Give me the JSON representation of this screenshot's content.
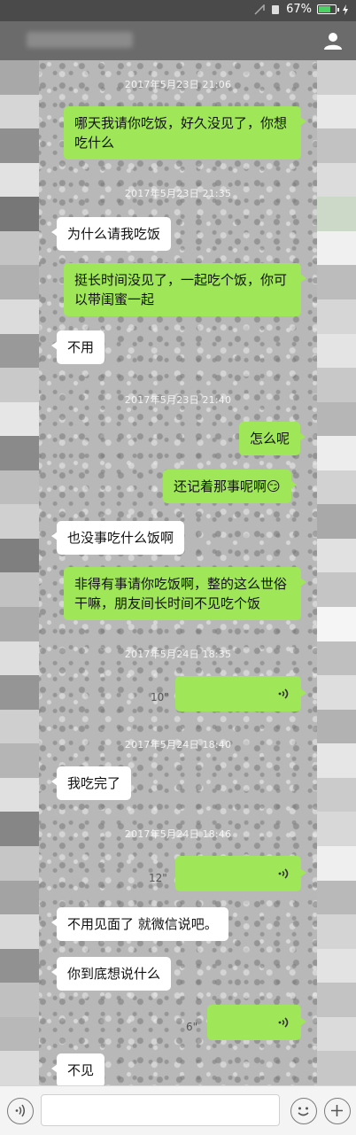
{
  "status_bar": {
    "battery_text": "67%",
    "battery_level": 0.67,
    "icons": [
      "signal-arrow-icon",
      "sim-icon",
      "battery-icon",
      "charging-bolt-icon"
    ]
  },
  "header": {
    "contact_icon": "person-icon"
  },
  "messages": [
    {
      "kind": "time",
      "text": "2017年5月23日 21:06"
    },
    {
      "kind": "text",
      "side": "right",
      "text": "哪天我请你吃饭，好久没见了，你想吃什么"
    },
    {
      "kind": "time",
      "text": "2017年5月23日 21:35"
    },
    {
      "kind": "text",
      "side": "left",
      "text": "为什么请我吃饭"
    },
    {
      "kind": "text",
      "side": "right",
      "text": "挺长时间没见了，一起吃个饭，你可以带闺蜜一起"
    },
    {
      "kind": "text",
      "side": "left",
      "text": "不用"
    },
    {
      "kind": "time",
      "text": "2017年5月23日 21:40"
    },
    {
      "kind": "text",
      "side": "right",
      "text": "怎么呢"
    },
    {
      "kind": "text",
      "side": "right",
      "text": "还记着那事呢啊😏"
    },
    {
      "kind": "text",
      "side": "left",
      "text": "也没事吃什么饭啊"
    },
    {
      "kind": "text",
      "side": "right",
      "text": "非得有事请你吃饭啊，整的这么世俗干嘛，朋友间长时间不见吃个饭"
    },
    {
      "kind": "time",
      "text": "2017年5月24日 18:35"
    },
    {
      "kind": "voice",
      "side": "right",
      "duration": "10\""
    },
    {
      "kind": "time",
      "text": "2017年5月24日 18:40"
    },
    {
      "kind": "text",
      "side": "left",
      "text": "我吃完了"
    },
    {
      "kind": "time",
      "text": "2017年5月24日 18:46"
    },
    {
      "kind": "voice",
      "side": "right",
      "duration": "12\""
    },
    {
      "kind": "text",
      "side": "left",
      "text": "不用见面了 就微信说吧。"
    },
    {
      "kind": "text",
      "side": "left",
      "text": "你到底想说什么"
    },
    {
      "kind": "voice",
      "side": "right",
      "duration": "6\""
    },
    {
      "kind": "text",
      "side": "left",
      "text": "不见"
    }
  ],
  "input_bar": {
    "icons": [
      "voice-toggle-icon",
      "emoji-icon",
      "more-plus-icon"
    ]
  },
  "colors": {
    "bubble_self": "#9fe658",
    "bubble_other": "#ffffff",
    "battery_green": "#4ed164"
  }
}
